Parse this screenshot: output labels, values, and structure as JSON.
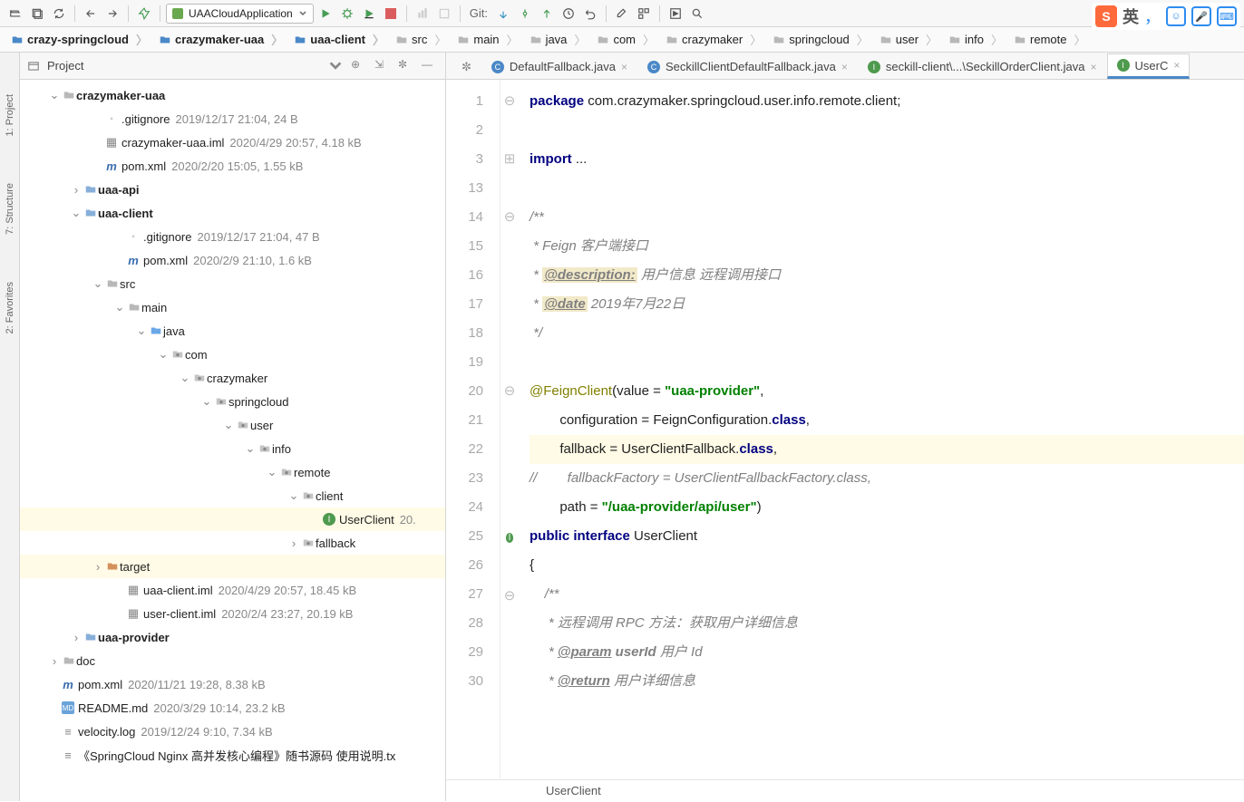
{
  "toolbar": {
    "run_config": "UAACloudApplication",
    "git_label": "Git:"
  },
  "breadcrumbs": [
    {
      "label": "crazy-springcloud",
      "bold": true
    },
    {
      "label": "crazymaker-uaa",
      "bold": true
    },
    {
      "label": "uaa-client",
      "bold": true
    },
    {
      "label": "src"
    },
    {
      "label": "main"
    },
    {
      "label": "java"
    },
    {
      "label": "com"
    },
    {
      "label": "crazymaker"
    },
    {
      "label": "springcloud"
    },
    {
      "label": "user"
    },
    {
      "label": "info"
    },
    {
      "label": "remote"
    }
  ],
  "panel": {
    "title": "Project"
  },
  "tree": [
    {
      "depth": 1,
      "twist": "v",
      "icon": "dir",
      "name": "crazymaker-uaa",
      "bold": true
    },
    {
      "depth": 3,
      "icon": "gitignore",
      "name": ".gitignore",
      "meta": "2019/12/17 21:04, 24 B"
    },
    {
      "depth": 3,
      "icon": "iml",
      "name": "crazymaker-uaa.iml",
      "meta": "2020/4/29 20:57, 4.18 kB"
    },
    {
      "depth": 3,
      "icon": "maven",
      "name": "pom.xml",
      "meta": "2020/2/20 15:05, 1.55 kB"
    },
    {
      "depth": 2,
      "twist": ">",
      "icon": "module",
      "name": "uaa-api",
      "bold": true
    },
    {
      "depth": 2,
      "twist": "v",
      "icon": "module",
      "name": "uaa-client",
      "bold": true
    },
    {
      "depth": 4,
      "icon": "gitignore",
      "name": ".gitignore",
      "meta": "2019/12/17 21:04, 47 B"
    },
    {
      "depth": 4,
      "icon": "maven",
      "name": "pom.xml",
      "meta": "2020/2/9 21:10, 1.6 kB"
    },
    {
      "depth": 3,
      "twist": "v",
      "icon": "dir",
      "name": "src"
    },
    {
      "depth": 4,
      "twist": "v",
      "icon": "dir",
      "name": "main"
    },
    {
      "depth": 5,
      "twist": "v",
      "icon": "src",
      "name": "java"
    },
    {
      "depth": 6,
      "twist": "v",
      "icon": "pkg",
      "name": "com"
    },
    {
      "depth": 7,
      "twist": "v",
      "icon": "pkg",
      "name": "crazymaker"
    },
    {
      "depth": 8,
      "twist": "v",
      "icon": "pkg",
      "name": "springcloud"
    },
    {
      "depth": 9,
      "twist": "v",
      "icon": "pkg",
      "name": "user"
    },
    {
      "depth": 10,
      "twist": "v",
      "icon": "pkg",
      "name": "info"
    },
    {
      "depth": 11,
      "twist": "v",
      "icon": "pkg",
      "name": "remote"
    },
    {
      "depth": 12,
      "twist": "v",
      "icon": "pkg",
      "name": "client"
    },
    {
      "depth": 13,
      "icon": "interface",
      "name": "UserClient",
      "meta": "20.",
      "selected": true
    },
    {
      "depth": 12,
      "twist": ">",
      "icon": "pkg",
      "name": "fallback"
    },
    {
      "depth": 3,
      "twist": ">",
      "icon": "target",
      "name": "target",
      "hl": true
    },
    {
      "depth": 4,
      "icon": "iml",
      "name": "uaa-client.iml",
      "meta": "2020/4/29 20:57, 18.45 kB"
    },
    {
      "depth": 4,
      "icon": "iml",
      "name": "user-client.iml",
      "meta": "2020/2/4 23:27, 20.19 kB"
    },
    {
      "depth": 2,
      "twist": ">",
      "icon": "module",
      "name": "uaa-provider",
      "bold": true
    },
    {
      "depth": 1,
      "twist": ">",
      "icon": "dir",
      "name": "doc"
    },
    {
      "depth": 1,
      "icon": "maven",
      "name": "pom.xml",
      "meta": "2020/11/21 19:28, 8.38 kB"
    },
    {
      "depth": 1,
      "icon": "md",
      "name": "README.md",
      "meta": "2020/3/29 10:14, 23.2 kB"
    },
    {
      "depth": 1,
      "icon": "file",
      "name": "velocity.log",
      "meta": "2019/12/24 9:10, 7.34 kB"
    },
    {
      "depth": 1,
      "icon": "file",
      "name": "《SpringCloud Nginx 高并发核心编程》随书源码 使用说明.tx"
    }
  ],
  "tabs": [
    {
      "icon": "gear",
      "color": "#6c707e",
      "label": "",
      "active": false,
      "closable": false
    },
    {
      "icon": "class",
      "color": "#4a88c7",
      "label": "DefaultFallback.java",
      "active": false
    },
    {
      "icon": "class",
      "color": "#4a88c7",
      "label": "SeckillClientDefaultFallback.java",
      "active": false
    },
    {
      "icon": "interface",
      "color": "#4e9a4e",
      "label": "seckill-client\\...\\SeckillOrderClient.java",
      "active": false
    },
    {
      "icon": "interface",
      "color": "#4e9a4e",
      "label": "UserC",
      "active": true
    }
  ],
  "gutter": [
    "1",
    "2",
    "3",
    "13",
    "14",
    "15",
    "16",
    "17",
    "18",
    "19",
    "20",
    "21",
    "22",
    "23",
    "24",
    "25",
    "26",
    "27",
    "28",
    "29",
    "30"
  ],
  "code": {
    "package": "package ",
    "pkg_name": "com.crazymaker.springcloud.user.info.remote.client;",
    "import": "import ",
    "import_rest": "...",
    "c1": "/**",
    "c2": " * Feign 客户端接口",
    "c3_pre": " * ",
    "c3_tag": "@description:",
    "c3_post": " 用户信息 远程调用接口",
    "c4_pre": " * ",
    "c4_tag": "@date",
    "c4_post": " 2019年7月22日",
    "c5": " */",
    "ann": "@FeignClient",
    "ann_rest1": "(value = ",
    "s1": "\"uaa-provider\"",
    "ann_rest1b": ",",
    "cfg": "        configuration = FeignConfiguration.",
    "cls": "class",
    "comma": ",",
    "fb": "        fallback = UserClientFallback.",
    "cm_ff": "//        fallbackFactory = UserClientFallbackFactory.class,",
    "path": "        path = ",
    "s2": "\"/uaa-provider/api/user\"",
    "pend": ")",
    "pub": "public ",
    "iface": "interface ",
    "cname": "UserClient",
    "brace": "{",
    "mc1": "    /**",
    "mc2": "     * 远程调用 RPC 方法：获取用户详细信息",
    "mc3_pre": "     * ",
    "mc3_tag": "@param",
    "mc3_mid": " userId",
    "mc3_post": " 用户 Id",
    "mc4_pre": "     * ",
    "mc4_tag": "@return",
    "mc4_post": " 用户详细信息"
  },
  "editor_breadcrumb": "UserClient",
  "ime": {
    "s": "S",
    "zh": "英"
  }
}
